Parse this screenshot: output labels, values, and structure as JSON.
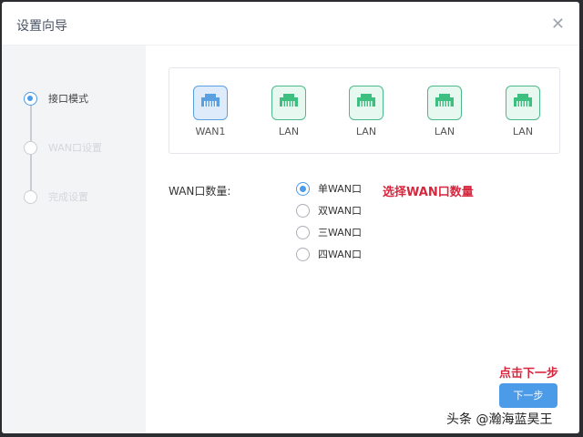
{
  "dialog": {
    "title": "设置向导",
    "close_icon": "close-icon"
  },
  "steps": [
    {
      "label": "接口模式",
      "active": true
    },
    {
      "label": "WAN口设置",
      "active": false
    },
    {
      "label": "完成设置",
      "active": false
    }
  ],
  "ports": [
    {
      "label": "WAN1",
      "type": "wan"
    },
    {
      "label": "LAN",
      "type": "lan"
    },
    {
      "label": "LAN",
      "type": "lan"
    },
    {
      "label": "LAN",
      "type": "lan"
    },
    {
      "label": "LAN",
      "type": "lan"
    }
  ],
  "wan_count": {
    "label": "WAN口数量:",
    "options": [
      "单WAN口",
      "双WAN口",
      "三WAN口",
      "四WAN口"
    ],
    "selected": "单WAN口"
  },
  "annotations": {
    "select_hint": "选择WAN口数量",
    "next_hint": "点击下一步"
  },
  "next_button": "下一步",
  "watermark": "头条 @瀚海蓝昊王",
  "colors": {
    "accent": "#4b9be9",
    "wan": "#5a9fe0",
    "lan": "#3dbf80",
    "annotation": "#d7263d"
  }
}
